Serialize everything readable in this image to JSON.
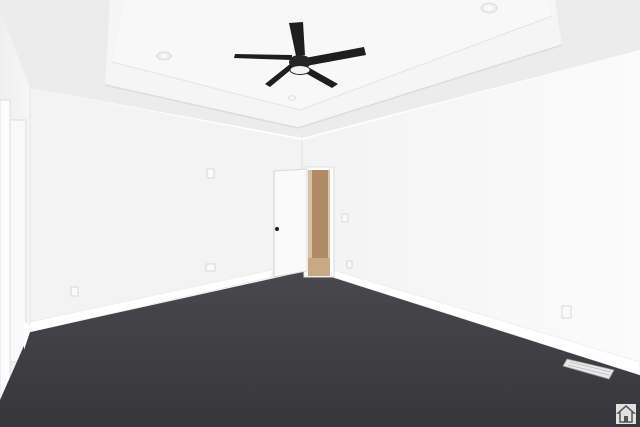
{
  "scene": {
    "type": "empty-bedroom",
    "features": [
      "tray-ceiling",
      "ceiling-fan",
      "recessed-lights",
      "open-door",
      "carpet-floor",
      "floor-vent",
      "wall-outlets",
      "baseboards"
    ]
  },
  "colors": {
    "ceiling": "#f0f0f0",
    "tray_ceiling": "#f7f7f7",
    "left_wall": "#f4f4f4",
    "back_wall": "#f5f5f5",
    "right_wall": "#f7f7f7",
    "carpet": "#3f3f44",
    "fan": "#1e1e1e",
    "door": "#fafafa",
    "hallway_wood": "#b08a66",
    "baseboard": "#ffffff"
  },
  "icons": {
    "fan": "ceiling-fan-icon",
    "watermark": "house-icon"
  }
}
